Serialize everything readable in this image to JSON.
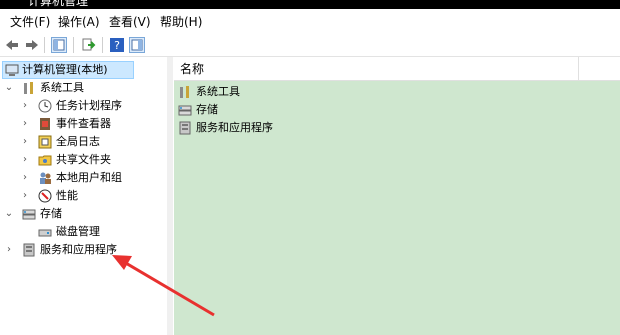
{
  "window": {
    "title": "计算机管理"
  },
  "menu": [
    "文件(F)",
    "操作(A)",
    "查看(V)",
    "帮助(H)"
  ],
  "toolbar": {
    "buttons": [
      "back-icon",
      "forward-icon",
      "show-hide-tree-icon",
      "export-list-icon",
      "help-icon",
      "show-action-pane-icon"
    ]
  },
  "tree": {
    "root": "计算机管理(本地)",
    "system_tools": {
      "label": "系统工具",
      "children": [
        "任务计划程序",
        "事件查看器",
        "全局日志",
        "共享文件夹",
        "本地用户和组",
        "性能"
      ]
    },
    "storage": {
      "label": "存储",
      "children": [
        "磁盘管理"
      ]
    },
    "services": {
      "label": "服务和应用程序"
    }
  },
  "list": {
    "column_name": "名称",
    "items": [
      "系统工具",
      "存储",
      "服务和应用程序"
    ]
  },
  "colors": {
    "list_bg": "#cfe7cf",
    "selection": "#cce8ff",
    "annotation_arrow": "#e8312f"
  }
}
